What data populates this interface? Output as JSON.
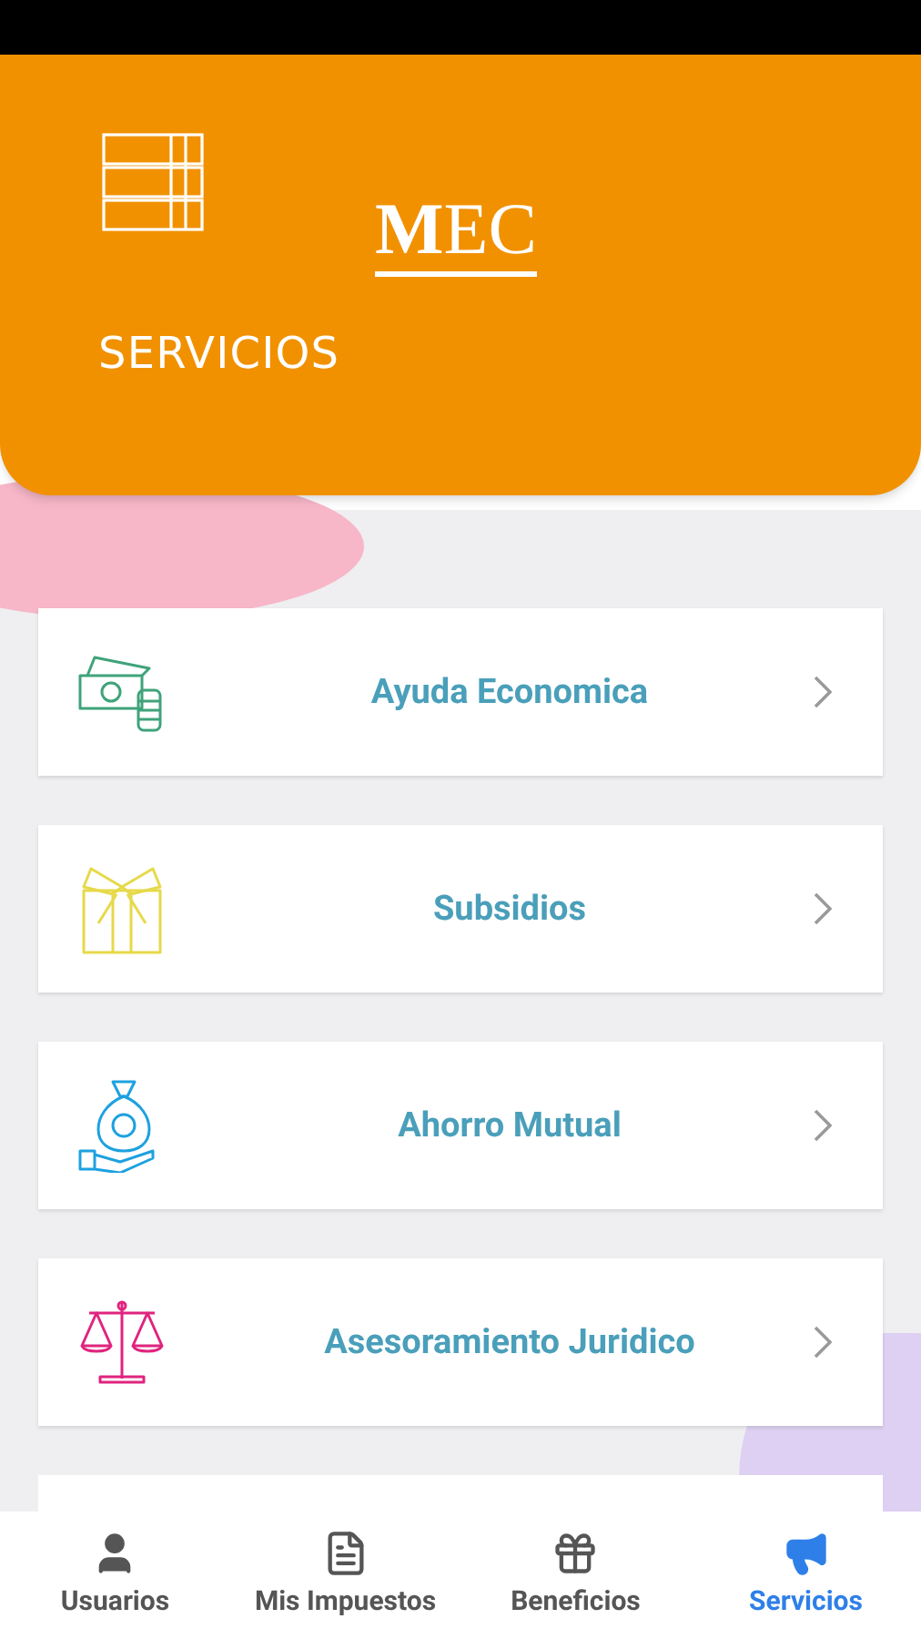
{
  "header": {
    "logo": "**M**EC",
    "title": "SERVICIOS"
  },
  "services": [
    {
      "kind": "money",
      "label": "Ayuda Economica"
    },
    {
      "kind": "gift",
      "label": "Subsidios"
    },
    {
      "kind": "moneybag",
      "label": "Ahorro Mutual"
    },
    {
      "kind": "scale",
      "label": "Asesoramiento Juridico"
    }
  ],
  "nav": [
    {
      "kind": "user",
      "label": "Usuarios",
      "selected": false
    },
    {
      "kind": "file",
      "label": "Mis Impuestos",
      "selected": false
    },
    {
      "kind": "gift",
      "label": "Beneficios",
      "selected": false
    },
    {
      "kind": "megaphone",
      "label": "Servicios",
      "selected": true
    }
  ]
}
